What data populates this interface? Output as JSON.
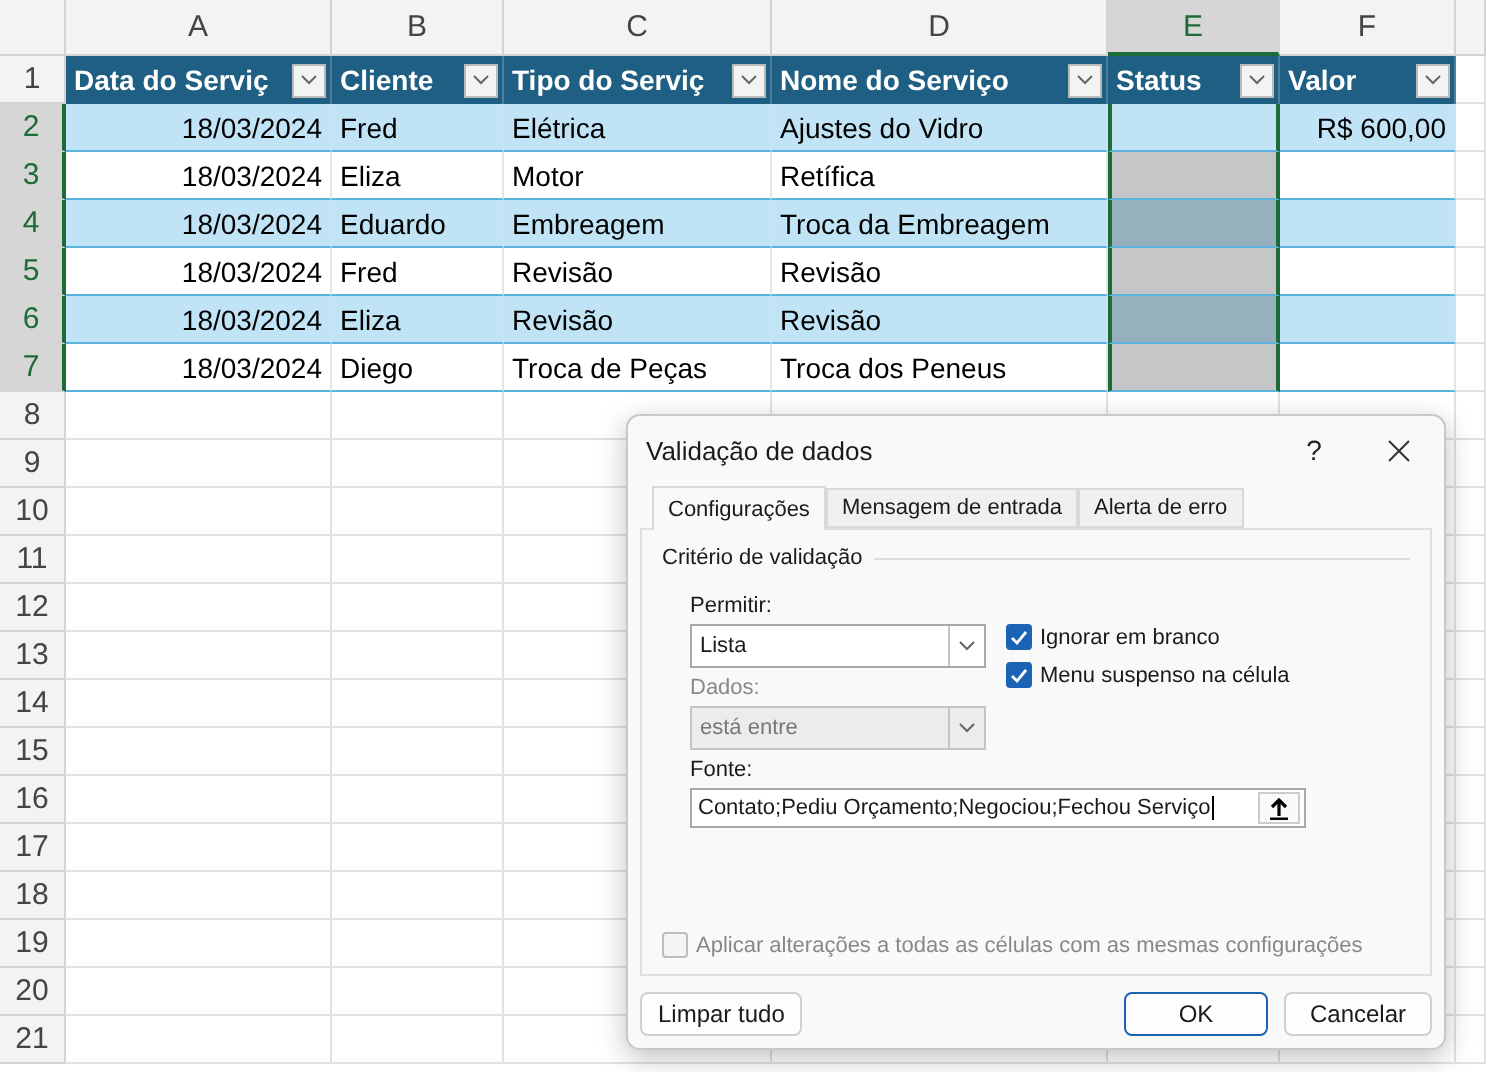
{
  "sheet": {
    "columns": [
      {
        "label": "A",
        "selected": false
      },
      {
        "label": "B",
        "selected": false
      },
      {
        "label": "C",
        "selected": false
      },
      {
        "label": "D",
        "selected": false
      },
      {
        "label": "E",
        "selected": true
      },
      {
        "label": "F",
        "selected": false
      }
    ],
    "row_headers": [
      {
        "label": "1",
        "selected": false
      },
      {
        "label": "2",
        "selected": true
      },
      {
        "label": "3",
        "selected": true
      },
      {
        "label": "4",
        "selected": true
      },
      {
        "label": "5",
        "selected": true
      },
      {
        "label": "6",
        "selected": true
      },
      {
        "label": "7",
        "selected": true
      },
      {
        "label": "8",
        "selected": false
      },
      {
        "label": "9",
        "selected": false
      },
      {
        "label": "10",
        "selected": false
      },
      {
        "label": "11",
        "selected": false
      },
      {
        "label": "12",
        "selected": false
      },
      {
        "label": "13",
        "selected": false
      },
      {
        "label": "14",
        "selected": false
      },
      {
        "label": "15",
        "selected": false
      },
      {
        "label": "16",
        "selected": false
      },
      {
        "label": "17",
        "selected": false
      },
      {
        "label": "18",
        "selected": false
      },
      {
        "label": "19",
        "selected": false
      },
      {
        "label": "20",
        "selected": false
      },
      {
        "label": "21",
        "selected": false
      }
    ],
    "table_headers": [
      "Data do Serviç",
      "Cliente",
      "Tipo do Serviç",
      "Nome do Serviço",
      "Status",
      "Valor"
    ],
    "rows": [
      {
        "active": true,
        "cells": [
          "18/03/2024",
          "Fred",
          "Elétrica",
          "Ajustes do Vidro",
          "",
          "R$ 600,00"
        ]
      },
      {
        "active": false,
        "cells": [
          "18/03/2024",
          "Eliza",
          "Motor",
          "Retífica",
          "",
          ""
        ]
      },
      {
        "active": false,
        "cells": [
          "18/03/2024",
          "Eduardo",
          "Embreagem",
          "Troca da Embreagem",
          "",
          ""
        ]
      },
      {
        "active": false,
        "cells": [
          "18/03/2024",
          "Fred",
          "Revisão",
          "Revisão",
          "",
          ""
        ]
      },
      {
        "active": false,
        "cells": [
          "18/03/2024",
          "Eliza",
          "Revisão",
          "Revisão",
          "",
          ""
        ]
      },
      {
        "active": false,
        "cells": [
          "18/03/2024",
          "Diego",
          "Troca de Peças",
          "Troca dos Peneus",
          "",
          ""
        ]
      }
    ]
  },
  "dialog": {
    "title": "Validação de dados",
    "help": "?",
    "tabs": [
      {
        "label": "Configurações",
        "selected": true
      },
      {
        "label": "Mensagem de entrada",
        "selected": false
      },
      {
        "label": "Alerta de erro",
        "selected": false
      }
    ],
    "section": "Critério de validação",
    "allow": {
      "label": "Permitir:",
      "value": "Lista",
      "disabled": false
    },
    "data": {
      "label": "Dados:",
      "value": "está entre",
      "disabled": true
    },
    "options": [
      {
        "label": "Ignorar em branco",
        "checked": true
      },
      {
        "label": "Menu suspenso na célula",
        "checked": true
      }
    ],
    "source": {
      "label": "Fonte:",
      "value": "Contato;Pediu Orçamento;Negociou;Fechou Serviço"
    },
    "apply_all": {
      "label": "Aplicar alterações a todas as células com as mesmas configurações",
      "checked": false,
      "disabled": true
    },
    "buttons": [
      {
        "label": "Limpar tudo",
        "kind": "secondary"
      },
      {
        "label": "OK",
        "kind": "primary"
      },
      {
        "label": "Cancelar",
        "kind": "secondary"
      }
    ]
  }
}
